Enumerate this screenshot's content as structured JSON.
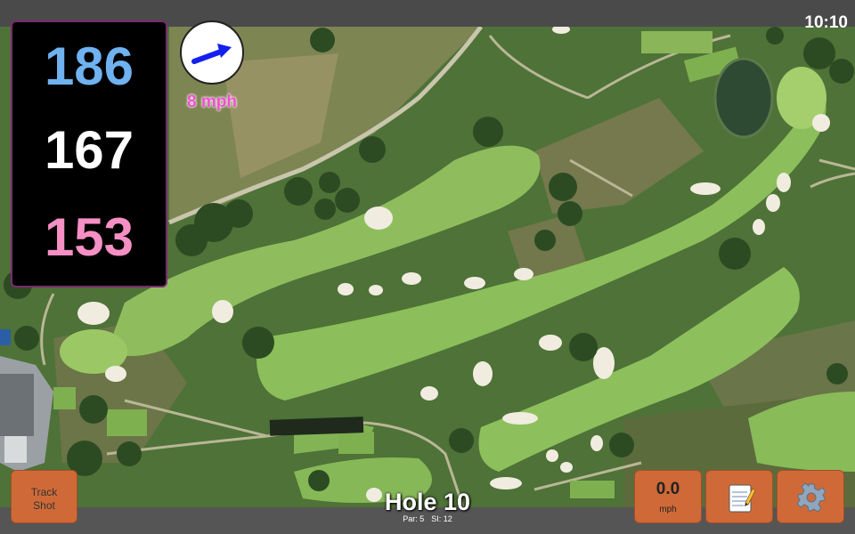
{
  "status": {
    "clock": "10:10"
  },
  "distances": {
    "back": "186",
    "middle": "167",
    "front": "153"
  },
  "wind": {
    "speed_label": "8 mph",
    "icon": "wind-direction-arrow"
  },
  "buttons": {
    "track_shot_line1": "Track",
    "track_shot_line2": "Shot",
    "speed_value": "0.0",
    "speed_unit": "mph",
    "notes_icon": "notepad-icon",
    "settings_icon": "gear-icon"
  },
  "hole": {
    "title": "Hole 10",
    "par": "Par: 5",
    "si": "SI: 12"
  },
  "colors": {
    "back": "#6fb2ef",
    "middle": "#ffffff",
    "front": "#f58fc4",
    "wind": "#f04fd0",
    "button": "#cf6a38",
    "panel_border": "#7a2a70"
  }
}
